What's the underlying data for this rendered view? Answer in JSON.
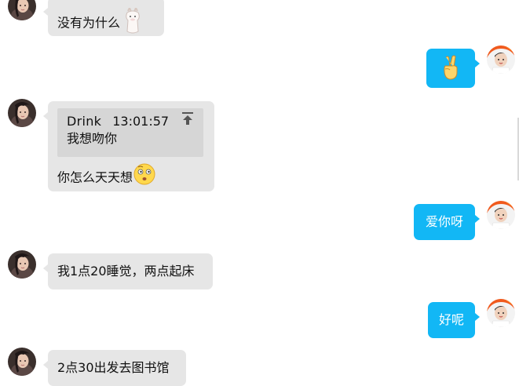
{
  "messages": [
    {
      "from": "other",
      "text": "没有为什么",
      "emoji": "alpaca-icon"
    },
    {
      "from": "me",
      "emoji": "victory-hand-icon"
    },
    {
      "from": "other",
      "quote": {
        "sender": "Drink",
        "time": "13:01:57",
        "text": "我想吻你"
      },
      "text": "你怎么天天想",
      "emoji": "thinking-face-icon"
    },
    {
      "from": "me",
      "text": "爱你呀"
    },
    {
      "from": "other",
      "text": "我1点20睡觉，两点起床"
    },
    {
      "from": "me",
      "text": "好呢"
    },
    {
      "from": "other",
      "text": "2点30出发去图书馆"
    }
  ],
  "colors": {
    "incoming_bubble": "#e6e6e6",
    "outgoing_bubble": "#12b7f5",
    "quote_background": "#d6d6d6"
  }
}
